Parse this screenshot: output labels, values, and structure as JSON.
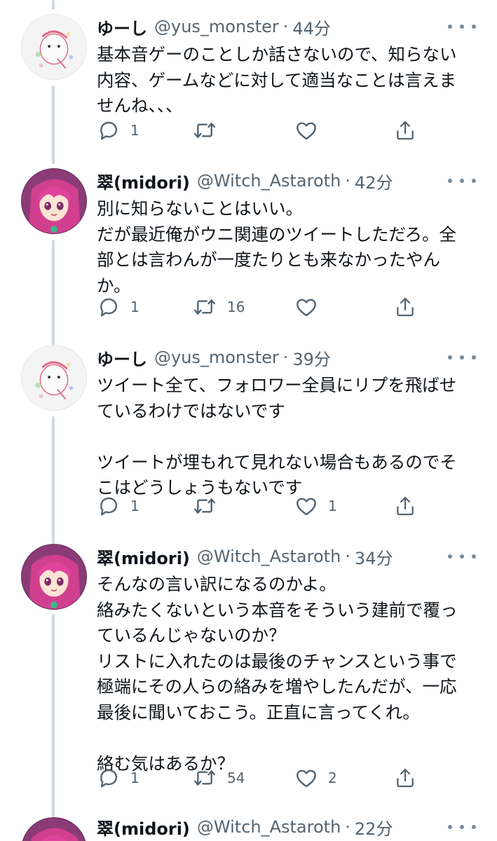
{
  "tweets": [
    {
      "name": "ゆーし",
      "handle": "@yus_monster",
      "time": "44分",
      "lines": [
        "基本音ゲーのことしか話さないので、知らない",
        "内容、ゲームなどに対して適当なことは言えま",
        "せんね、、、"
      ],
      "reply_count": "1",
      "retweet_count": "",
      "like_count": ""
    },
    {
      "name": "翠(midori)",
      "handle": "@Witch_Astaroth",
      "time": "42分",
      "lines": [
        "別に知らないことはいい。",
        "だが最近俺がウニ関連のツイートしただろ。全",
        "部とは言わんが一度たりとも来なかったやん",
        "か。"
      ],
      "reply_count": "1",
      "retweet_count": "16",
      "like_count": ""
    },
    {
      "name": "ゆーし",
      "handle": "@yus_monster",
      "time": "39分",
      "lines": [
        "ツイート全て、フォロワー全員にリプを飛ばせ",
        "ているわけではないです",
        "",
        "ツイートが埋もれて見れない場合もあるのでそ",
        "こはどうしょうもないです"
      ],
      "reply_count": "1",
      "retweet_count": "",
      "like_count": "1"
    },
    {
      "name": "翠(midori)",
      "handle": "@Witch_Astaroth",
      "time": "34分",
      "lines": [
        "そんなの言い訳になるのかよ。",
        "絡みたくないという本音をそういう建前で覆っ",
        "ているんじゃないのか？",
        "リストに入れたのは最後のチャンスという事で",
        "極端にその人らの絡みを増やしたんだが、一応",
        "最後に聞いておこう。正直に言ってくれ。",
        "",
        "絡む気はあるか？"
      ],
      "reply_count": "1",
      "retweet_count": "54",
      "like_count": "2"
    },
    {
      "name": "翠(midori)",
      "handle": "@Witch_Astaroth",
      "time": "22分"
    }
  ],
  "separator": "·",
  "icons": {
    "reply": "reply-icon",
    "retweet": "retweet-icon",
    "like": "heart-icon",
    "share": "share-icon",
    "more": "more-icon"
  },
  "colors": {
    "text": "#0f1419",
    "secondary": "#536471",
    "thread_line": "#cfd9de"
  }
}
